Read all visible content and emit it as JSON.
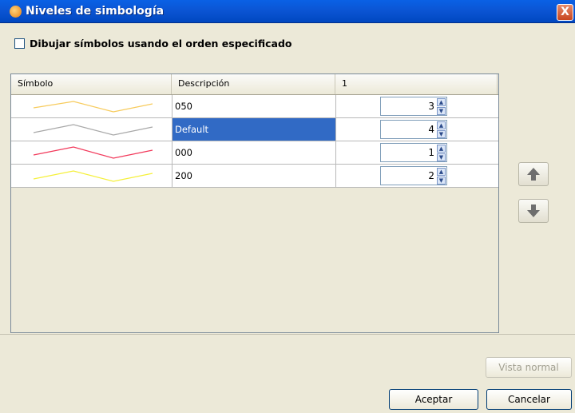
{
  "window": {
    "title": "Niveles de simbología",
    "close_label": "X"
  },
  "options": {
    "order_checkbox_label": "Dibujar símbolos usando el orden especificado",
    "order_checked": false
  },
  "table": {
    "columns": [
      "Símbolo",
      "Descripción",
      "1"
    ],
    "rows": [
      {
        "color": "#f7cb5c",
        "description": "050",
        "level": "3",
        "selected": false
      },
      {
        "color": "#a8a8a8",
        "description": "Default",
        "level": "4",
        "selected": true
      },
      {
        "color": "#f2385a",
        "description": "000",
        "level": "1",
        "selected": false
      },
      {
        "color": "#f5f03b",
        "description": "200",
        "level": "2",
        "selected": false
      }
    ]
  },
  "side_buttons": {
    "up_icon": "arrow-up-icon",
    "down_icon": "arrow-down-icon"
  },
  "buttons": {
    "normal_view": "Vista normal",
    "accept": "Aceptar",
    "cancel": "Cancelar"
  }
}
